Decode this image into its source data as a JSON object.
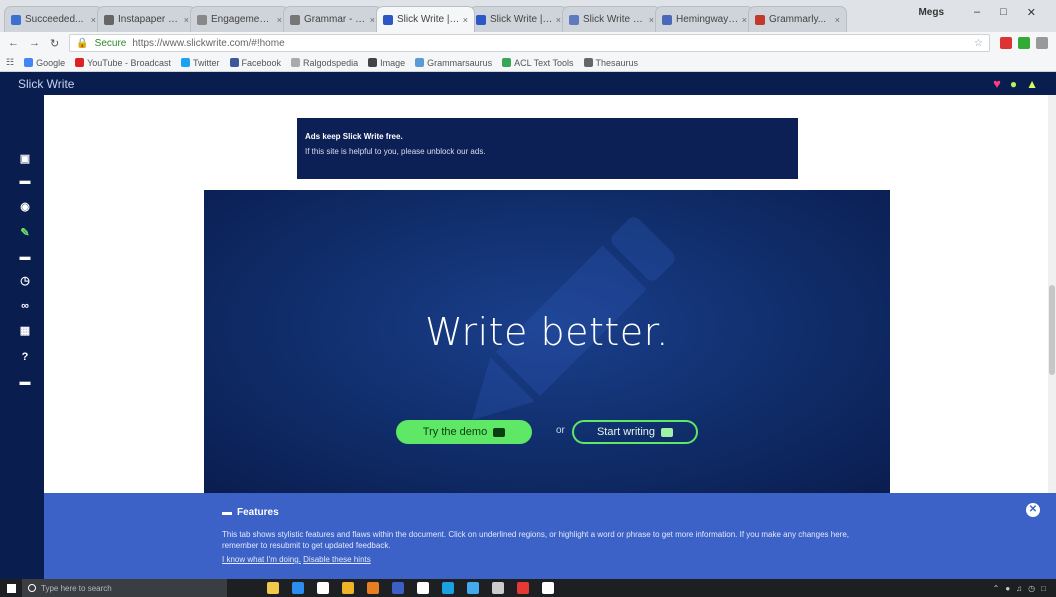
{
  "browser": {
    "tabs": [
      {
        "label": "Succeeded...",
        "active": false,
        "color": "#3b6fd1"
      },
      {
        "label": "Instapaper - yo...",
        "active": false,
        "color": "#666666"
      },
      {
        "label": "Engagement...",
        "active": false,
        "color": "#888888"
      },
      {
        "label": "Grammar - Lesson...",
        "active": false,
        "color": "#777777"
      },
      {
        "label": "Slick Write | H...",
        "active": true,
        "color": "#2b58c5"
      },
      {
        "label": "Slick Write | Fr...",
        "active": false,
        "color": "#2b58c5"
      },
      {
        "label": "Slick Write Stats...",
        "active": false,
        "color": "#5d7bbf"
      },
      {
        "label": "Hemingway Ed...",
        "active": false,
        "color": "#4a68b8"
      },
      {
        "label": "Grammarly...",
        "active": false,
        "color": "#c0392b"
      }
    ],
    "user": "Megs",
    "address": {
      "secure_label": "Secure",
      "url": "https://www.slickwrite.com/#!home"
    },
    "bookmarks": [
      {
        "label": "Google",
        "color": "#4285f4"
      },
      {
        "label": "YouTube - Broadcast",
        "color": "#e02020"
      },
      {
        "label": "Twitter",
        "color": "#1da1f2"
      },
      {
        "label": "Facebook",
        "color": "#3b5998"
      },
      {
        "label": "Ralgodspedia",
        "color": "#aaaaaa"
      },
      {
        "label": "Image",
        "color": "#444444"
      },
      {
        "label": "Grammarsaurus",
        "color": "#5b9bd5"
      },
      {
        "label": "ACL Text Tools",
        "color": "#3aa655"
      },
      {
        "label": "Thesaurus",
        "color": "#666666"
      }
    ]
  },
  "app": {
    "title": "Slick Write"
  },
  "sidebar": {
    "icons": [
      "save-icon",
      "folder-icon",
      "eye-icon",
      "pencil-icon",
      "stats-icon",
      "clock-icon",
      "link-icon",
      "grid-icon",
      "help-icon",
      "comment-icon"
    ]
  },
  "ad": {
    "title": "Ads keep Slick Write free.",
    "text": "If this site is helpful to you, please unblock our ads."
  },
  "hero": {
    "title": "Write better.",
    "demo_label": "Try the demo",
    "or_label": "or",
    "start_label": "Start writing"
  },
  "features": {
    "title": "Features",
    "text": "This tab shows stylistic features and flaws within the document. Click on underlined regions, or highlight a word or phrase to get more information. If you make any changes here, remember to resubmit to get updated feedback.",
    "link_prefix": "I know what I'm doing.",
    "link_label": "Disable these hints"
  },
  "taskbar": {
    "search_placeholder": "Type here to search",
    "apps": [
      "#f2c94c",
      "#2d8cf0",
      "#ffffff",
      "#f0b429",
      "#e67e22",
      "#3b5fc4",
      "#ffffff",
      "#1ba1e2",
      "#44aaee",
      "#cccccc",
      "#e53935",
      "#ffffff"
    ]
  }
}
